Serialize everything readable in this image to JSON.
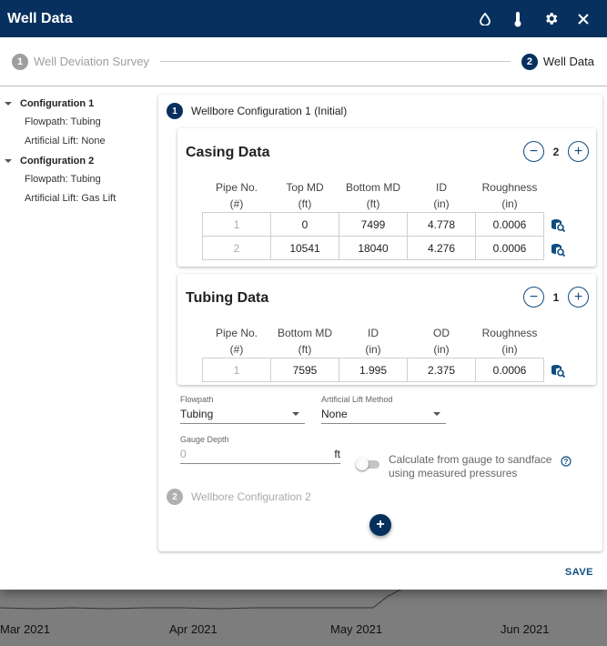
{
  "dialog": {
    "title": "Well Data",
    "icons": [
      "droplet-icon",
      "thermometer-icon",
      "gear-icon",
      "close-icon"
    ]
  },
  "stepper": {
    "steps": [
      {
        "number": "1",
        "label": "Well Deviation Survey",
        "state": "inactive"
      },
      {
        "number": "2",
        "label": "Well Data",
        "state": "active"
      }
    ]
  },
  "tree": {
    "configs": [
      {
        "label": "Configuration 1",
        "children": [
          "Flowpath: Tubing",
          "Artificial Lift: None"
        ]
      },
      {
        "label": "Configuration 2",
        "children": [
          "Flowpath: Tubing",
          "Artificial Lift: Gas Lift"
        ]
      }
    ]
  },
  "config1": {
    "number": "1",
    "title": "Wellbore Configuration 1 (Initial)",
    "casing": {
      "title": "Casing Data",
      "count": "2",
      "headers": [
        [
          "Pipe No.",
          "(#)"
        ],
        [
          "Top MD",
          "(ft)"
        ],
        [
          "Bottom MD",
          "(ft)"
        ],
        [
          "ID",
          "(in)"
        ],
        [
          "Roughness",
          "(in)"
        ]
      ],
      "rows": [
        [
          "1",
          "0",
          "7499",
          "4.778",
          "0.0006"
        ],
        [
          "2",
          "10541",
          "18040",
          "4.276",
          "0.0006"
        ]
      ]
    },
    "tubing": {
      "title": "Tubing Data",
      "count": "1",
      "headers": [
        [
          "Pipe No.",
          "(#)"
        ],
        [
          "Bottom MD",
          "(ft)"
        ],
        [
          "ID",
          "(in)"
        ],
        [
          "OD",
          "(in)"
        ],
        [
          "Roughness",
          "(in)"
        ]
      ],
      "rows": [
        [
          "1",
          "7595",
          "1.995",
          "2.375",
          "0.0006"
        ]
      ]
    },
    "flowpath": {
      "label": "Flowpath",
      "value": "Tubing"
    },
    "lift": {
      "label": "Artificial Lift Method",
      "value": "None"
    },
    "gauge": {
      "label": "Gauge Depth",
      "value": "0",
      "unit": "ft"
    },
    "toggle_text": "Calculate from gauge to sandface using measured pressures",
    "toggle_on": false
  },
  "config2": {
    "number": "2",
    "title": "Wellbore Configuration 2"
  },
  "save_label": "SAVE",
  "background_chart": {
    "x_labels": [
      "Mar 2021",
      "Apr 2021",
      "May 2021",
      "Jun 2021"
    ]
  }
}
